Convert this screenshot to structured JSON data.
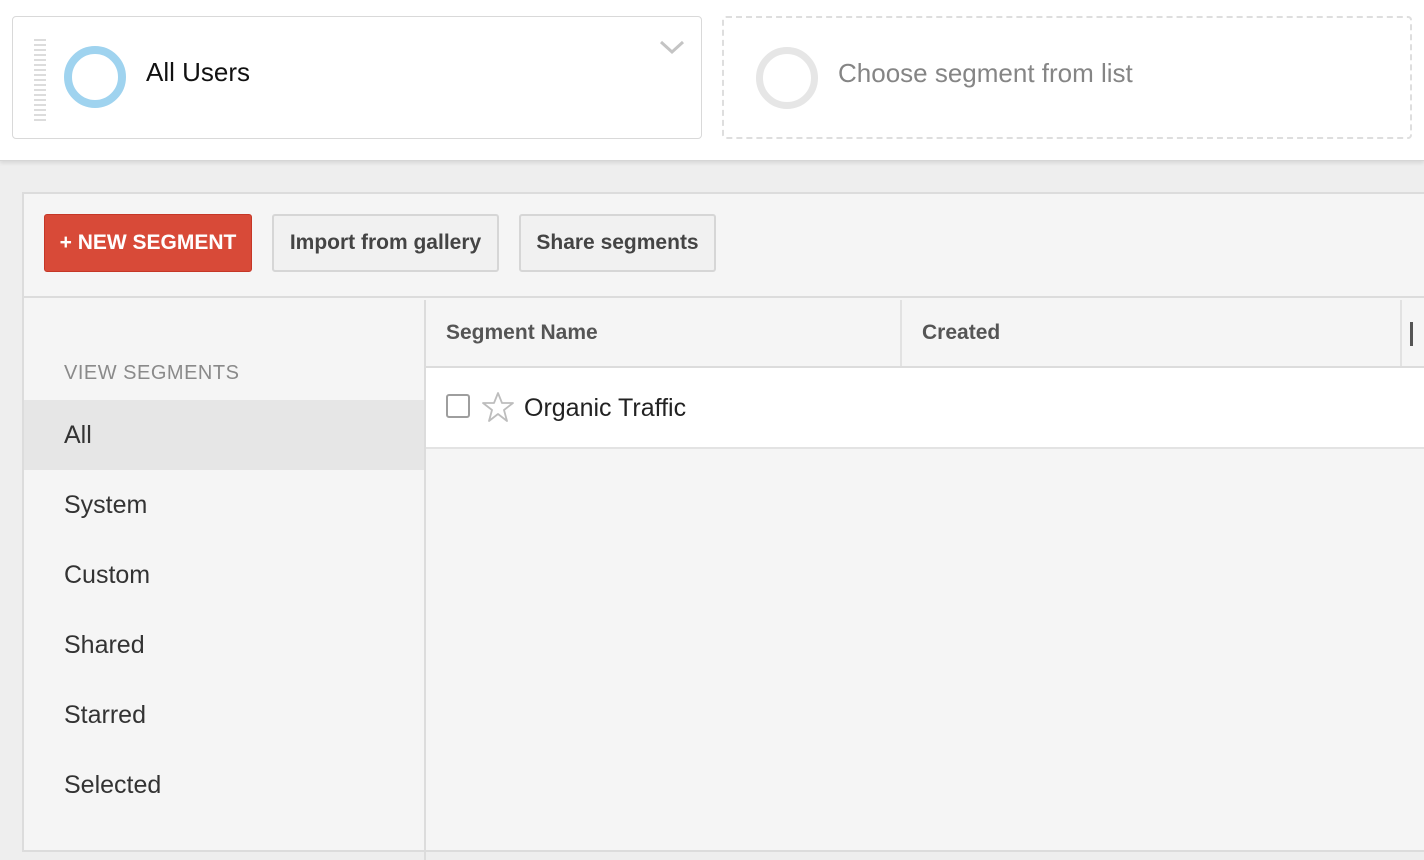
{
  "segments_bar": {
    "active_segment": {
      "name": "All Users",
      "color": "#9fd3ef",
      "icon": "chevron-down-icon"
    },
    "placeholder_segment": {
      "text": "Choose segment from list"
    }
  },
  "toolbar": {
    "new_segment_label": "+ NEW SEGMENT",
    "import_label": "Import from gallery",
    "share_label": "Share segments",
    "accent_color": "#d84a38"
  },
  "sidebar": {
    "heading": "VIEW SEGMENTS",
    "items": [
      {
        "label": "All",
        "selected": true
      },
      {
        "label": "System",
        "selected": false
      },
      {
        "label": "Custom",
        "selected": false
      },
      {
        "label": "Shared",
        "selected": false
      },
      {
        "label": "Starred",
        "selected": false
      },
      {
        "label": "Selected",
        "selected": false
      }
    ]
  },
  "table": {
    "columns": [
      "Segment Name",
      "Created"
    ],
    "rows": [
      {
        "name": "Organic Traffic",
        "created": "",
        "starred": false,
        "checked": false
      }
    ]
  }
}
